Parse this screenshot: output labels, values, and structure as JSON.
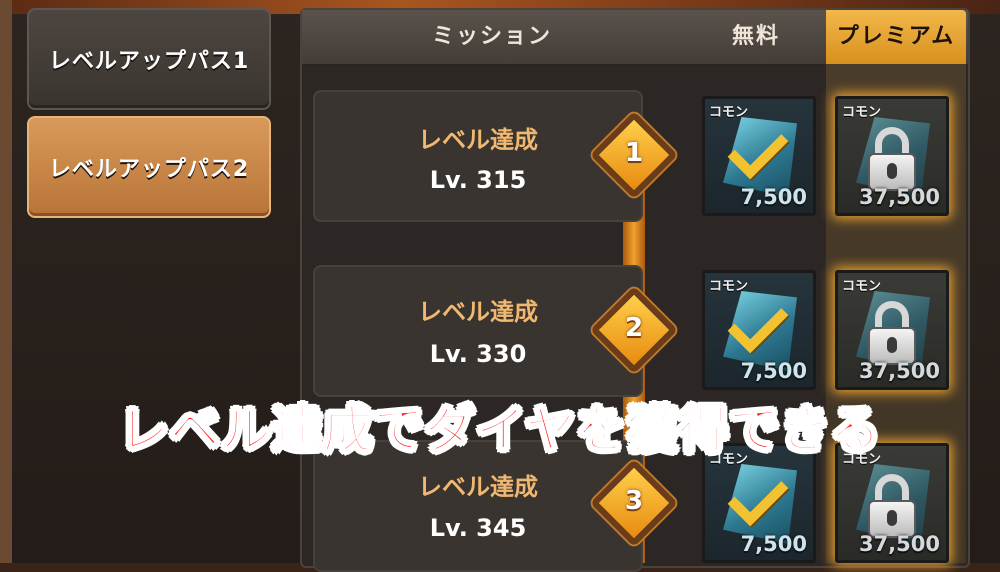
{
  "tabs": {
    "pass1": "レベルアップパス1",
    "pass2": "レベルアップパス2"
  },
  "header": {
    "mission": "ミッション",
    "free": "無料",
    "premium": "プレミアム"
  },
  "rows": [
    {
      "title": "レベル達成",
      "level": "Lv. 315",
      "step": "1",
      "free": {
        "label": "コモン",
        "amount": "7,500",
        "status": "claimed"
      },
      "premium": {
        "label": "コモン",
        "amount": "37,500",
        "status": "locked"
      }
    },
    {
      "title": "レベル達成",
      "level": "Lv. 330",
      "step": "2",
      "free": {
        "label": "コモン",
        "amount": "7,500",
        "status": "claimed"
      },
      "premium": {
        "label": "コモン",
        "amount": "37,500",
        "status": "locked"
      }
    },
    {
      "title": "レベル達成",
      "level": "Lv. 345",
      "step": "3",
      "free": {
        "label": "コモン",
        "amount": "7,500",
        "status": "claimed"
      },
      "premium": {
        "label": "コモン",
        "amount": "37,500",
        "status": "locked"
      }
    }
  ],
  "banner": "レベル達成でダイヤを獲得できる",
  "colors": {
    "accent": "#f2b84a",
    "banner_red": "#ff1a1a",
    "active_tab": "#c8853f"
  }
}
